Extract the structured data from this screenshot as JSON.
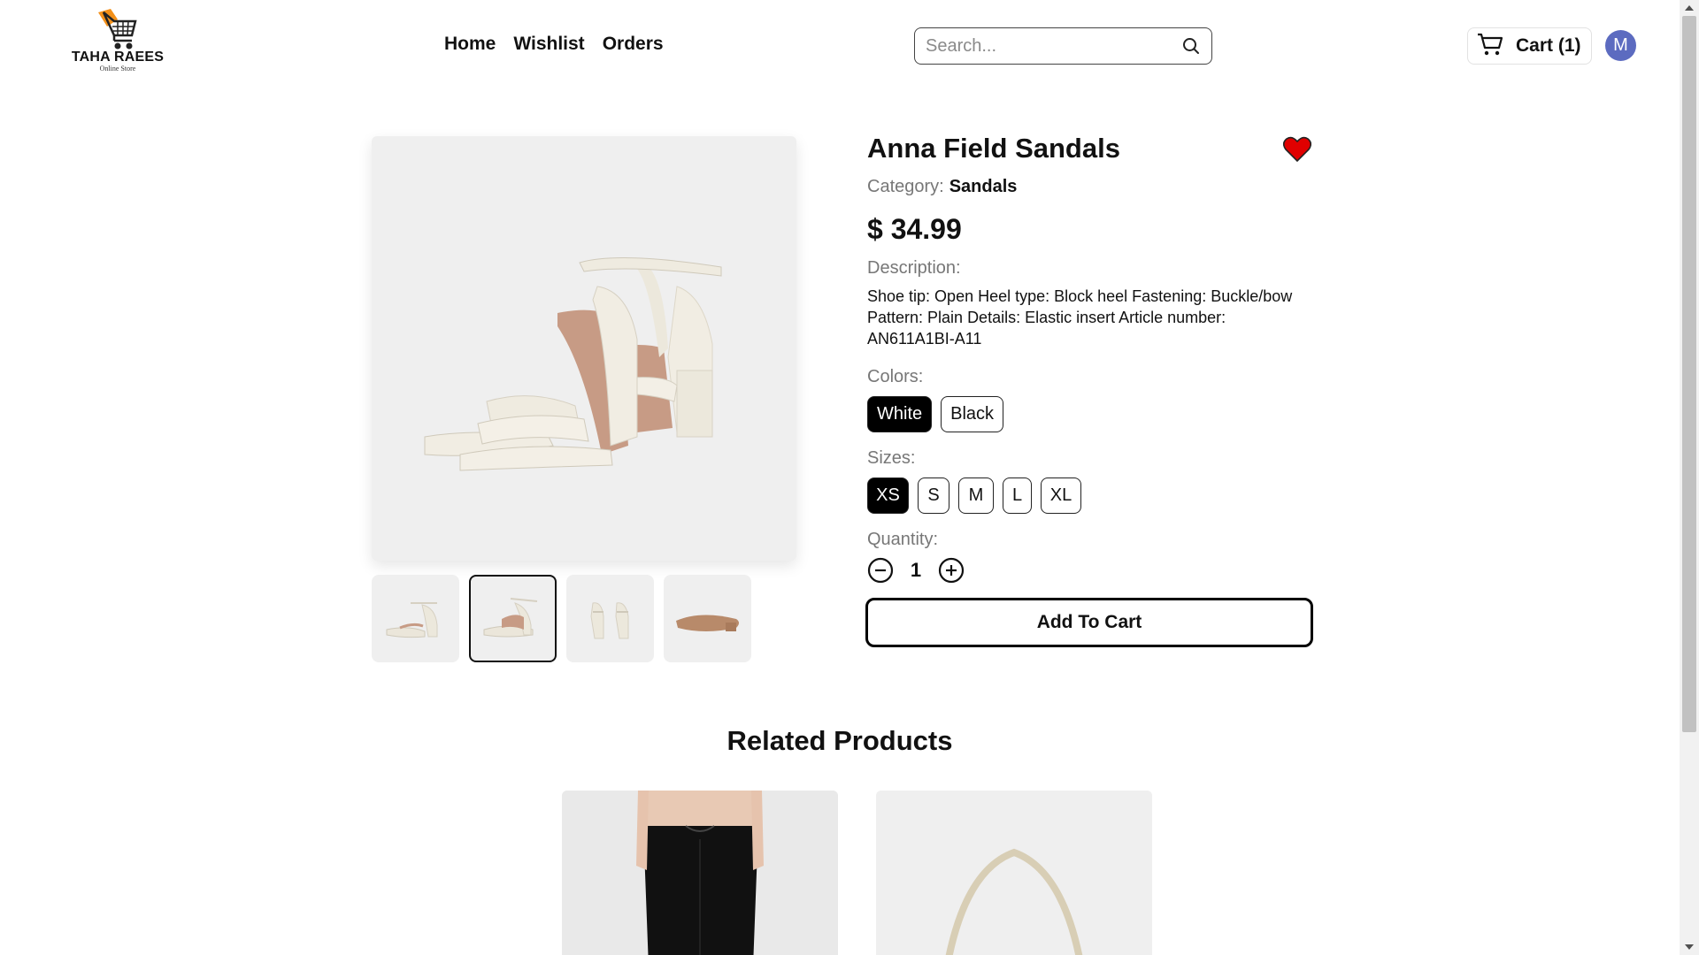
{
  "brand": {
    "name": "TAHA RAEES",
    "tagline": "Online Store"
  },
  "nav": {
    "items": [
      {
        "label": "Home"
      },
      {
        "label": "Wishlist"
      },
      {
        "label": "Orders"
      }
    ]
  },
  "search": {
    "placeholder": "Search...",
    "value": "",
    "icon": "search-icon"
  },
  "cart": {
    "label": "Cart (1)",
    "icon": "cart-icon"
  },
  "user": {
    "initial": "M",
    "color": "#5c6bc0"
  },
  "product": {
    "title": "Anna Field Sandals",
    "favorited": true,
    "category_label": "Category:",
    "category": "Sandals",
    "price": "$ 34.99",
    "description_label": "Description:",
    "description": "Shoe tip: Open Heel type: Block heel Fastening: Buckle/bow Pattern: Plain Details: Elastic insert Article number: AN611A1BI-A11",
    "colors_label": "Colors:",
    "colors": [
      {
        "label": "White",
        "selected": true
      },
      {
        "label": "Black",
        "selected": false
      }
    ],
    "sizes_label": "Sizes:",
    "sizes": [
      {
        "label": "XS",
        "selected": true
      },
      {
        "label": "S",
        "selected": false
      },
      {
        "label": "M",
        "selected": false
      },
      {
        "label": "L",
        "selected": false
      },
      {
        "label": "XL",
        "selected": false
      }
    ],
    "quantity_label": "Quantity:",
    "quantity": "1",
    "add_to_cart": "Add To Cart",
    "active_thumbnail": 2
  },
  "related": {
    "title": "Related Products"
  },
  "colors": {
    "heart": "#e00000",
    "accent": "#000000",
    "logo_orange": "#f39019"
  }
}
